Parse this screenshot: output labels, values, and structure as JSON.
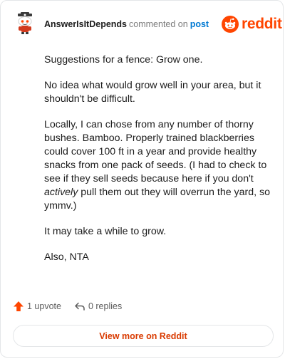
{
  "header": {
    "username": "AnswerIsItDepends",
    "commented_text": "commented on",
    "post_link": "post",
    "brand": "reddit",
    "brand_color": "#ff4500",
    "avatar_icon": "snoo-avatar-icon"
  },
  "comment": {
    "p1": "Suggestions for a fence: Grow one.",
    "p2": "No idea what would grow well in your area, but it shouldn't be difficult.",
    "p3_before": "Locally, I can chose from any number of thorny bushes. Bamboo. Properly trained blackberries could cover 100 ft in a year and provide healthy snacks from one pack of seeds. (I had to check to see if they sell seeds because here if you don't ",
    "p3_emph": "actively",
    "p3_after": " pull them out they will overrun the yard, so ymmv.)",
    "p4": "It may take a while to grow.",
    "p5": "Also, NTA"
  },
  "footer": {
    "upvotes": "1 upvote",
    "upvote_icon": "upvote-arrow-icon",
    "upvote_color": "#ff4500",
    "replies": "0 replies",
    "reply_icon": "reply-arrow-icon",
    "view_more": "View more on Reddit",
    "view_more_color": "#d93a00"
  }
}
